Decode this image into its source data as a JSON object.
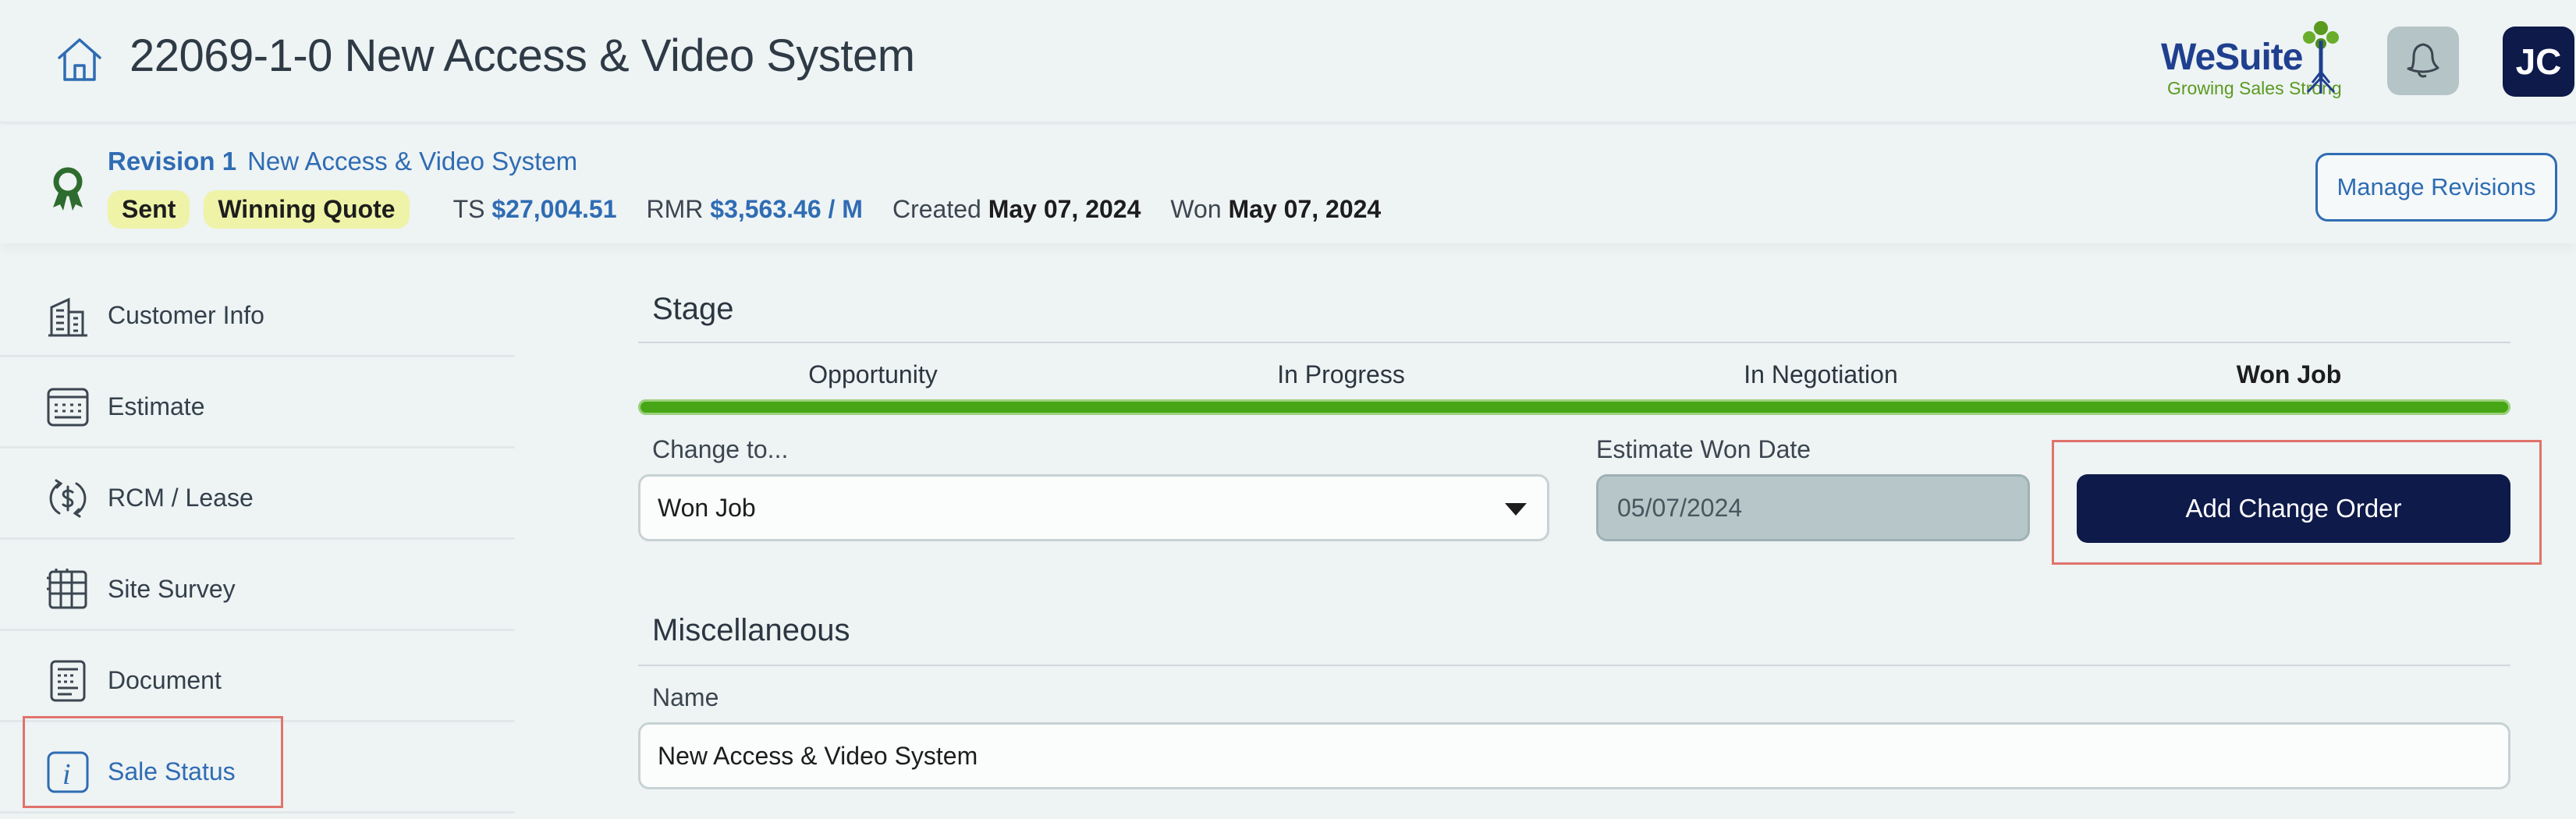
{
  "header": {
    "title": "22069-1-0 New Access & Video System",
    "brand_name": "WeSuite",
    "brand_tagline": "Growing Sales Strong",
    "avatar_initials": "JC",
    "icons": {
      "home": "home-icon",
      "notifications": "bell-icon"
    }
  },
  "revision": {
    "label": "Revision 1",
    "name": "New Access & Video System",
    "badges": [
      "Sent",
      "Winning Quote"
    ],
    "ts_label": "TS",
    "ts_value": "$27,004.51",
    "rmr_label": "RMR",
    "rmr_value": "$3,563.46 / M",
    "created_label": "Created",
    "created_value": "May 07, 2024",
    "won_label": "Won",
    "won_value": "May 07, 2024",
    "manage_button": "Manage Revisions",
    "icon": "award-ribbon-icon"
  },
  "sidebar": {
    "items": [
      {
        "label": "Customer Info",
        "icon": "building-icon"
      },
      {
        "label": "Estimate",
        "icon": "calculator-icon"
      },
      {
        "label": "RCM / Lease",
        "icon": "recurring-dollar-icon"
      },
      {
        "label": "Site Survey",
        "icon": "floor-plan-icon"
      },
      {
        "label": "Document",
        "icon": "document-icon"
      },
      {
        "label": "Sale Status",
        "icon": "info-icon",
        "active": true
      }
    ]
  },
  "stage": {
    "title": "Stage",
    "steps": [
      "Opportunity",
      "In Progress",
      "In Negotiation",
      "Won Job"
    ],
    "current_step": "Won Job",
    "progress": 1.0,
    "change_to_label": "Change to...",
    "change_to_value": "Won Job",
    "won_date_label": "Estimate Won Date",
    "won_date_value": "05/07/2024",
    "add_change_order": "Add Change Order"
  },
  "misc": {
    "title": "Miscellaneous",
    "name_label": "Name",
    "name_value": "New Access & Video System"
  },
  "colors": {
    "accent_blue": "#2f6cb3",
    "navy": "#0e1a4a",
    "progress_green": "#46a615",
    "badge_yellow": "#eef3a8",
    "highlight_red": "#e0736b"
  }
}
